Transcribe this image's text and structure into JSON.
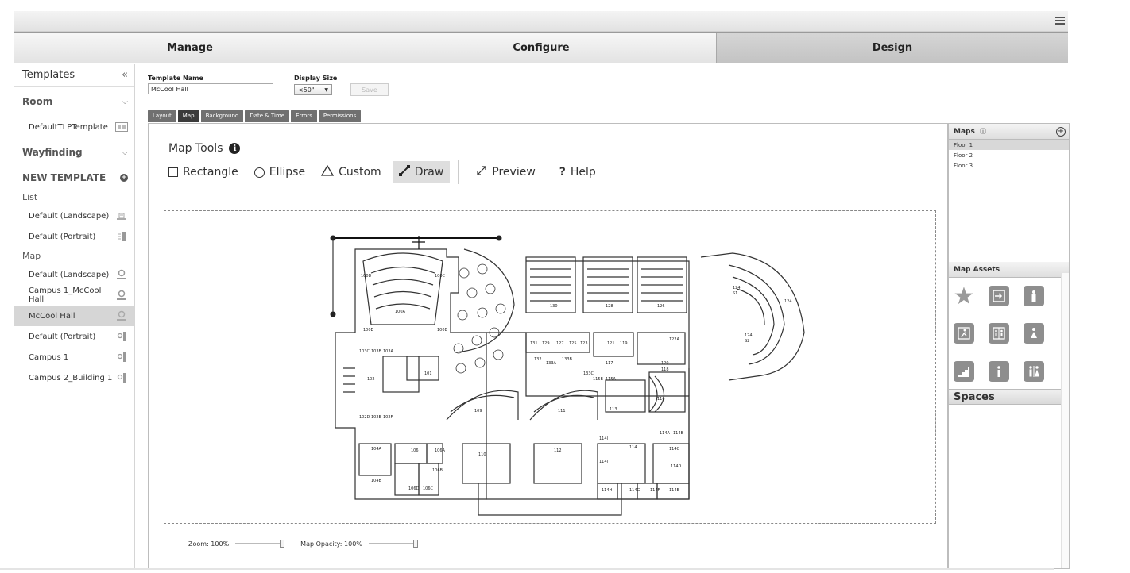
{
  "nav": {
    "tabs": [
      {
        "label": "Manage"
      },
      {
        "label": "Configure"
      },
      {
        "label": "Design"
      }
    ]
  },
  "sidebar": {
    "title": "Templates",
    "collapse_glyph": "«",
    "groups": [
      {
        "label": "Room",
        "items": [
          {
            "label": "DefaultTLPTemplate",
            "icon": "room-template-icon"
          }
        ]
      },
      {
        "label": "Wayfinding"
      }
    ],
    "new_template_label": "NEW TEMPLATE",
    "list_section": "List",
    "list_items": [
      {
        "label": "Default (Landscape)",
        "icon": "list-landscape-icon"
      },
      {
        "label": "Default (Portrait)",
        "icon": "list-portrait-icon"
      }
    ],
    "map_section": "Map",
    "map_items": [
      {
        "label": "Default (Landscape)",
        "icon": "map-pin-icon"
      },
      {
        "label": "Campus 1_McCool Hall",
        "icon": "map-pin-icon"
      },
      {
        "label": "McCool Hall",
        "icon": "map-pin-icon",
        "selected": true
      },
      {
        "label": "Default (Portrait)",
        "icon": "map-portrait-icon"
      },
      {
        "label": "Campus 1",
        "icon": "map-portrait-icon"
      },
      {
        "label": "Campus 2_Building 1",
        "icon": "map-portrait-icon"
      }
    ]
  },
  "form": {
    "template_name_label": "Template Name",
    "template_name_value": "McCool Hall",
    "display_size_label": "Display Size",
    "display_size_value": "<50\"",
    "save_label": "Save"
  },
  "subtabs": [
    "Layout",
    "Map",
    "Background",
    "Date & Time",
    "Errors",
    "Permissions"
  ],
  "map_tools": {
    "title": "Map Tools",
    "info_glyph": "i",
    "tools": {
      "rectangle": "Rectangle",
      "ellipse": "Ellipse",
      "custom": "Custom",
      "draw": "Draw",
      "preview": "Preview",
      "help": "Help"
    }
  },
  "controls": {
    "zoom_label": "Zoom: 100%",
    "zoom_value": 100,
    "opacity_label": "Map Opacity: 100%",
    "opacity_value": 100
  },
  "right_panel": {
    "maps_title": "Maps",
    "maps": [
      "Floor 1",
      "Floor 2",
      "Floor 3"
    ],
    "selected_map": "Floor 1",
    "assets_title": "Map Assets",
    "assets": [
      "star-icon",
      "exit-icon",
      "restroom-male-icon",
      "emergency-exit-icon",
      "elevator-icon",
      "restroom-female-icon",
      "stairs-icon",
      "info-icon",
      "restroom-family-icon"
    ],
    "spaces_title": "Spaces"
  },
  "floorplan_rooms": [
    "100D",
    "100C",
    "100A",
    "100B",
    "100E",
    "103C",
    "103B",
    "103A",
    "102",
    "101",
    "102D",
    "102E",
    "102F",
    "104A",
    "104B",
    "106",
    "106A",
    "106B",
    "106D",
    "106C",
    "109",
    "110",
    "111",
    "112",
    "113",
    "114",
    "114A",
    "114B",
    "114C",
    "114D",
    "114E",
    "114F",
    "114G",
    "114H",
    "114I",
    "114J",
    "116",
    "117",
    "115A",
    "115B",
    "118",
    "119",
    "121",
    "122",
    "123",
    "125",
    "126",
    "127",
    "128",
    "129",
    "130",
    "131",
    "132",
    "133A",
    "133B",
    "133C",
    "120",
    "124",
    "124 S1",
    "124 S2"
  ]
}
